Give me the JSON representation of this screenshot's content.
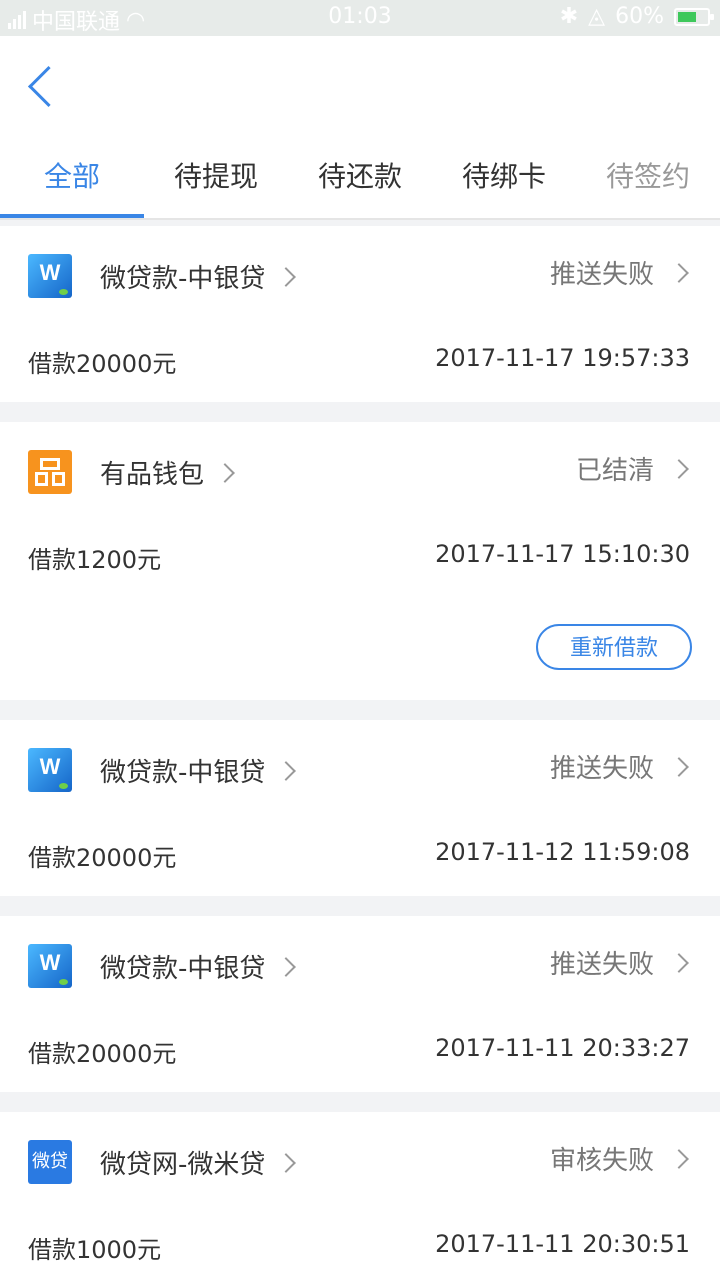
{
  "status_bar": {
    "carrier": "中国联通",
    "time": "01:03",
    "battery": "60%"
  },
  "tabs": [
    {
      "label": "全部",
      "active": true
    },
    {
      "label": "待提现",
      "active": false
    },
    {
      "label": "待还款",
      "active": false
    },
    {
      "label": "待绑卡",
      "active": false
    },
    {
      "label": "待签约",
      "active": false
    }
  ],
  "loans": [
    {
      "logo": "weidaikuan-logo",
      "title": "微贷款-中银贷",
      "status": "推送失败",
      "amount": "借款20000元",
      "time": "2017-11-17 19:57:33"
    },
    {
      "logo": "youpin-logo",
      "title": "有品钱包",
      "status": "已结清",
      "amount": "借款1200元",
      "time": "2017-11-17 15:10:30",
      "action": "重新借款"
    },
    {
      "logo": "weidaikuan-logo",
      "title": "微贷款-中银贷",
      "status": "推送失败",
      "amount": "借款20000元",
      "time": "2017-11-12 11:59:08"
    },
    {
      "logo": "weidaikuan-logo",
      "title": "微贷款-中银贷",
      "status": "推送失败",
      "amount": "借款20000元",
      "time": "2017-11-11 20:33:27"
    },
    {
      "logo": "weidaiwang-logo",
      "logo_text": "微贷",
      "title": "微贷网-微米贷",
      "status": "审核失败",
      "amount": "借款1000元",
      "time": "2017-11-11 20:30:51"
    }
  ],
  "colors": {
    "accent": "#3a86e6",
    "background": "#f2f3f5"
  }
}
